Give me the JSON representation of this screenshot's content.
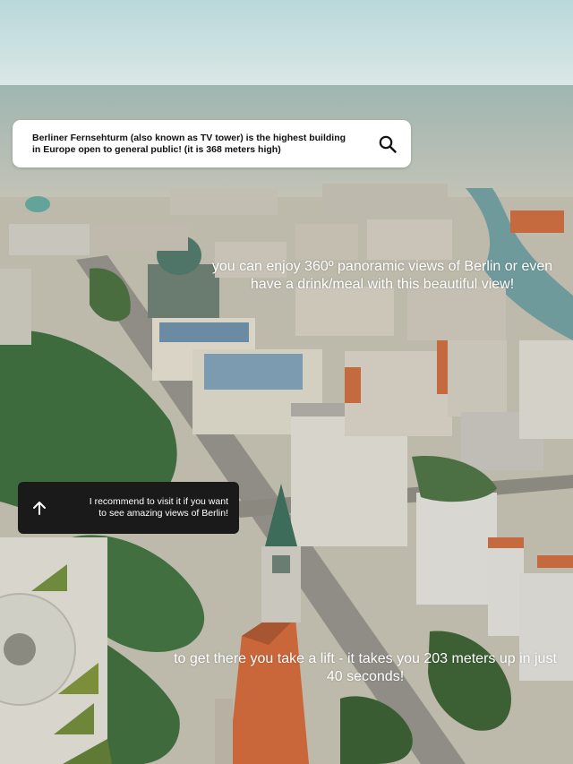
{
  "search": {
    "text": "Berliner Fernsehturm (also known as TV tower) is the highest building\nin Europe open to general public! (it is 368 meters high)",
    "icon": "search-icon"
  },
  "captions": {
    "views": "you can enjoy 360º panoramic views of Berlin or even have a drink/meal with this beautiful view!",
    "lift": "to get there you take a lift - it takes you 203 meters up in just 40 seconds!"
  },
  "recommendation": {
    "text": "I recommend to visit it if you want\nto see amazing views of Berlin!",
    "icon": "arrow-up-icon"
  },
  "colors": {
    "sky": "#cfe3e3",
    "card_white": "#ffffff",
    "card_dark": "#1a1a1a",
    "caption_text": "#ffffff"
  }
}
